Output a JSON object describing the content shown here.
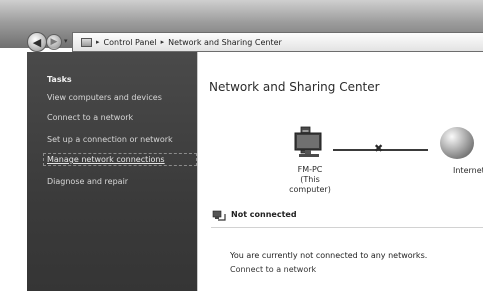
{
  "address_bar": {
    "crumbs": [
      "Control Panel",
      "Network and Sharing Center"
    ]
  },
  "sidebar": {
    "title": "Tasks",
    "items": [
      {
        "label": "View computers and devices"
      },
      {
        "label": "Connect to a network"
      },
      {
        "label": "Set up a connection or network"
      },
      {
        "label": "Manage network connections",
        "selected": true
      },
      {
        "label": "Diagnose and repair"
      }
    ]
  },
  "main": {
    "title": "Network and Sharing Center",
    "computer": {
      "name": "FM-PC",
      "subtitle": "(This computer)"
    },
    "internet_label": "Internet",
    "status": {
      "label": "Not connected"
    },
    "message": "You are currently not connected to any networks.",
    "connect_link": "Connect to a network"
  },
  "icons": {
    "back": "back-arrow-icon",
    "forward": "forward-arrow-icon",
    "address": "control-panel-icon",
    "computer": "computer-icon",
    "internet": "globe-icon",
    "disconnect": "disconnected-x-icon",
    "status": "network-status-icon"
  }
}
